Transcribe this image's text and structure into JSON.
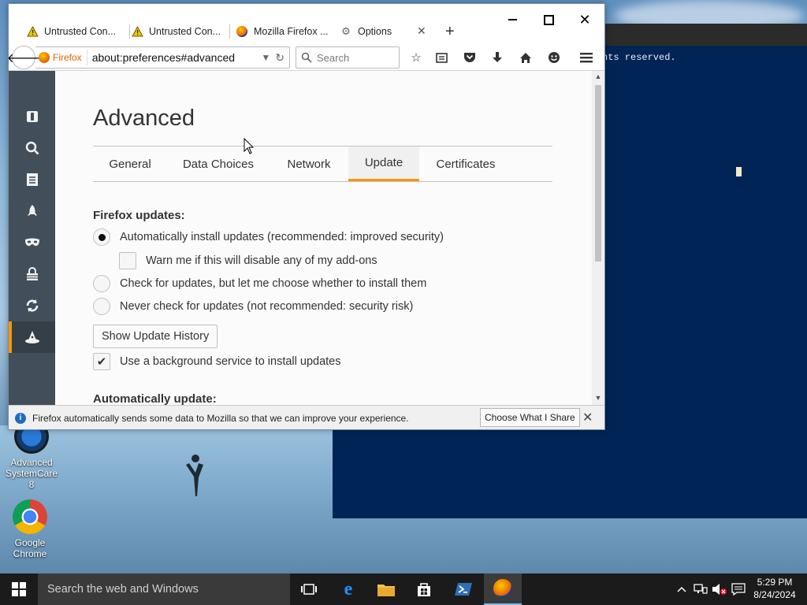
{
  "browser": {
    "tabs": [
      {
        "label": "Untrusted Con...",
        "icon": "warning-icon"
      },
      {
        "label": "Untrusted Con...",
        "icon": "warning-icon"
      },
      {
        "label": "Mozilla Firefox ...",
        "icon": "firefox-icon"
      },
      {
        "label": "Options",
        "icon": "gear-icon"
      }
    ],
    "identity_label": "Firefox",
    "url": "about:preferences#advanced",
    "search_placeholder": "Search"
  },
  "sidebar": {
    "items": [
      {
        "name": "general",
        "icon": "switch-icon"
      },
      {
        "name": "search",
        "icon": "search-icon"
      },
      {
        "name": "content",
        "icon": "document-icon"
      },
      {
        "name": "applications",
        "icon": "rocket-icon"
      },
      {
        "name": "privacy",
        "icon": "mask-icon"
      },
      {
        "name": "security",
        "icon": "lock-icon"
      },
      {
        "name": "sync",
        "icon": "sync-icon"
      },
      {
        "name": "advanced",
        "icon": "wizard-hat-icon",
        "active": true
      }
    ]
  },
  "prefs": {
    "title": "Advanced",
    "tabs": [
      "General",
      "Data Choices",
      "Network",
      "Update",
      "Certificates"
    ],
    "selected_tab": "Update",
    "section_updates": "Firefox updates:",
    "options": [
      {
        "label": "Automatically install updates (recommended: improved security)",
        "checked": true
      },
      {
        "label": "Warn me if this will disable any of my add-ons",
        "checked": false
      },
      {
        "label": "Check for updates, but let me choose whether to install them",
        "checked": false
      },
      {
        "label": "Never check for updates (not recommended: security risk)",
        "checked": false
      }
    ],
    "history_button": "Show Update History",
    "background_service": "Use a background service to install updates",
    "background_service_checked": true,
    "section_auto": "Automatically update:"
  },
  "notification": {
    "text": "Firefox automatically sends some data to Mozilla so that we can improve your experience.",
    "button": "Choose What I Share"
  },
  "console": {
    "text": "hts reserved."
  },
  "desktop_icons": [
    {
      "label1": "Advanced",
      "label2": "SystemCare 8"
    },
    {
      "label1": "Google",
      "label2": "Chrome"
    }
  ],
  "taskbar": {
    "search_placeholder": "Search the web and Windows",
    "time": "5:29 PM",
    "date": "8/24/2024"
  },
  "colors": {
    "accent": "#ff9500",
    "sidebar": "#424f5a",
    "console_bg": "#012456"
  }
}
